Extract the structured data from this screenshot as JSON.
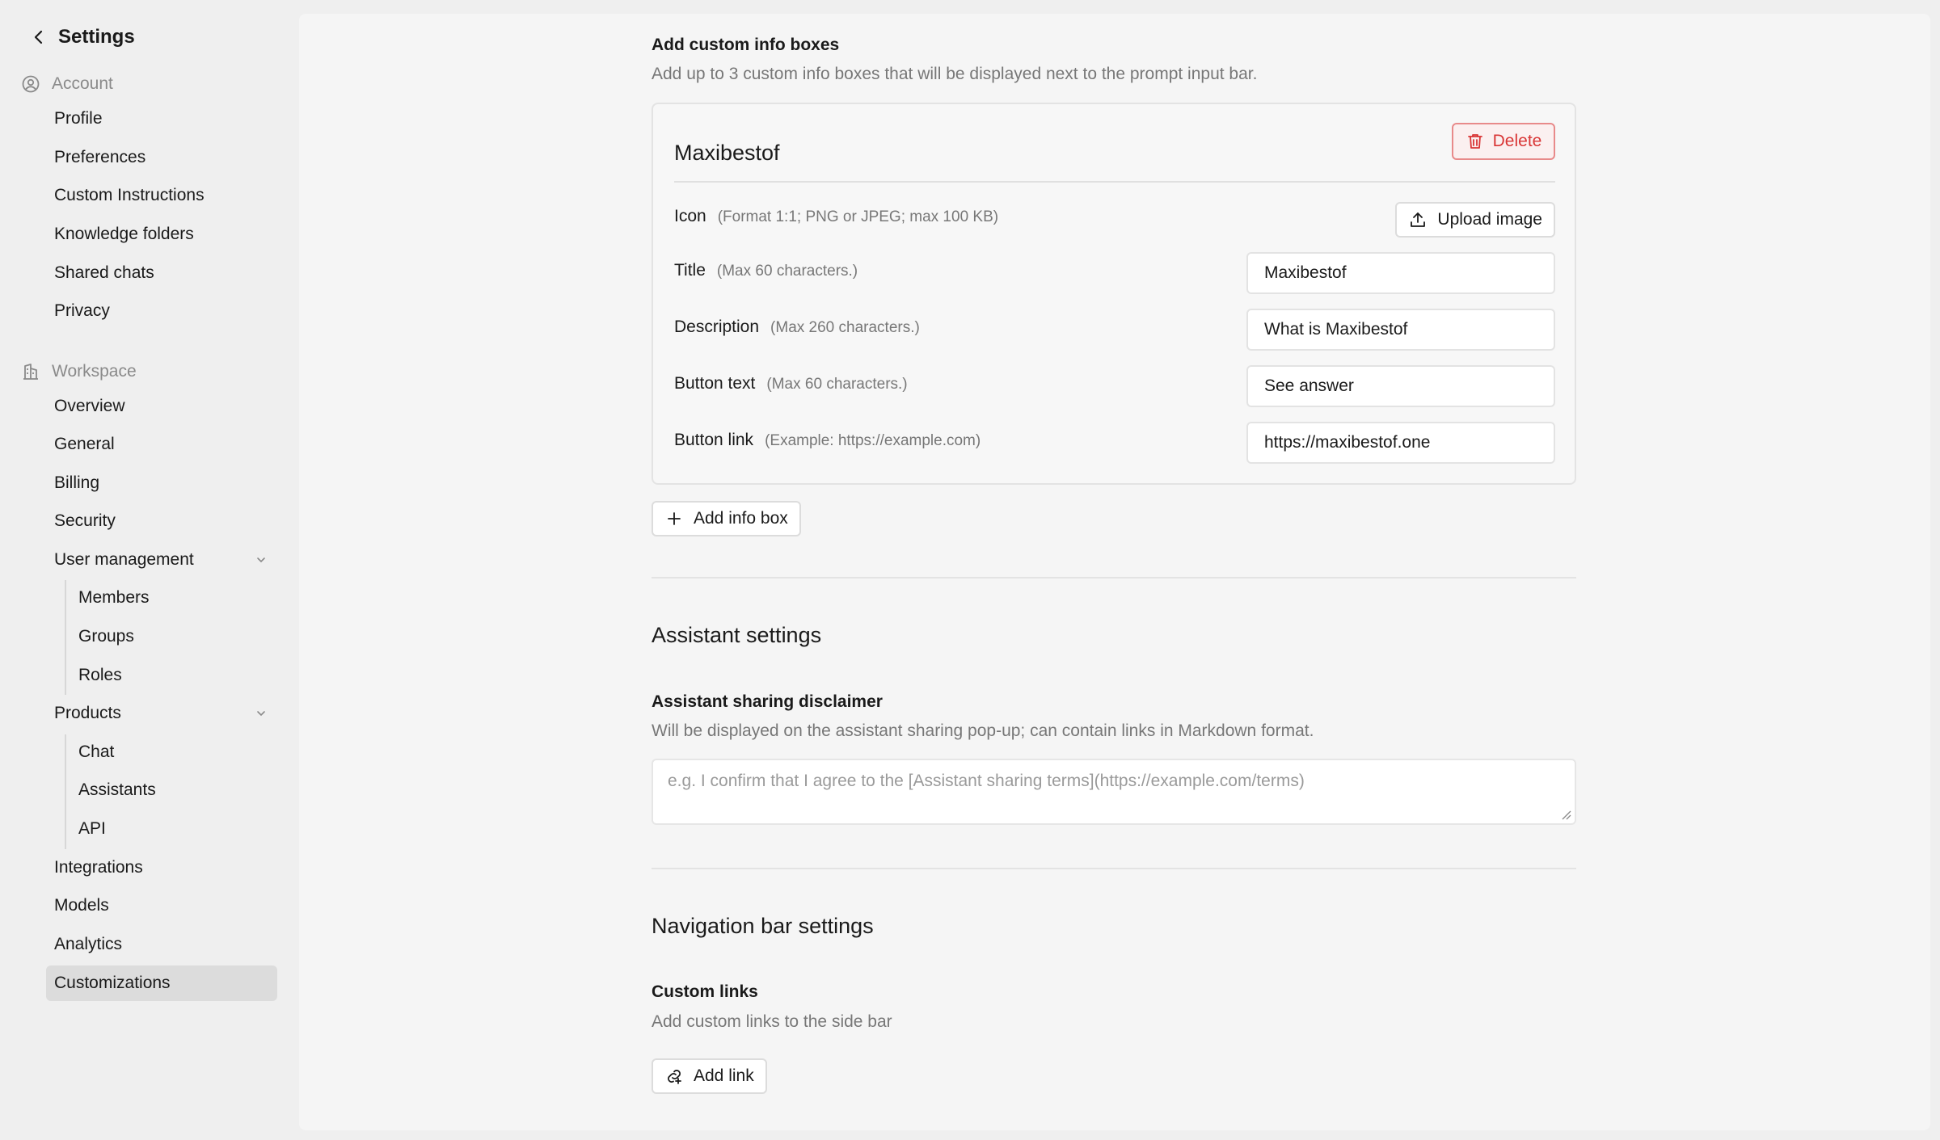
{
  "sidebar": {
    "header": {
      "title": "Settings"
    },
    "account": {
      "label": "Account",
      "items": [
        "Profile",
        "Preferences",
        "Custom Instructions",
        "Knowledge folders",
        "Shared chats",
        "Privacy"
      ]
    },
    "workspace": {
      "label": "Workspace",
      "items": {
        "overview": "Overview",
        "general": "General",
        "billing": "Billing",
        "security": "Security",
        "user_management": "User management",
        "members": "Members",
        "groups": "Groups",
        "roles": "Roles",
        "products": "Products",
        "chat": "Chat",
        "assistants": "Assistants",
        "api": "API",
        "integrations": "Integrations",
        "models": "Models",
        "analytics": "Analytics",
        "customizations": "Customizations"
      }
    }
  },
  "info_boxes": {
    "title": "Add custom info boxes",
    "description": "Add up to 3 custom info boxes that will be displayed next to the prompt input bar.",
    "card": {
      "name": "Maxibestof",
      "delete_label": "Delete",
      "icon": {
        "label": "Icon",
        "hint": "(Format 1:1; PNG or JPEG; max 100 KB)",
        "upload_label": "Upload image"
      },
      "title_field": {
        "label": "Title",
        "hint": "(Max 60 characters.)",
        "value": "Maxibestof"
      },
      "description_field": {
        "label": "Description",
        "hint": "(Max 260 characters.)",
        "value": "What is Maxibestof"
      },
      "button_text_field": {
        "label": "Button text",
        "hint": "(Max 60 characters.)",
        "value": "See answer"
      },
      "button_link_field": {
        "label": "Button link",
        "hint": "(Example: https://example.com)",
        "value": "https://maxibestof.one"
      }
    },
    "add_label": "Add info box"
  },
  "assistant_settings": {
    "title": "Assistant settings",
    "disclaimer_label": "Assistant sharing disclaimer",
    "disclaimer_description": "Will be displayed on the assistant sharing pop-up; can contain links in Markdown format.",
    "disclaimer_placeholder": "e.g. I confirm that I agree to the [Assistant sharing terms](https://example.com/terms)"
  },
  "navigation_settings": {
    "title": "Navigation bar settings",
    "links_label": "Custom links",
    "links_description": "Add custom links to the side bar",
    "add_link_label": "Add link"
  },
  "colors": {
    "danger": "#d93636",
    "active_item_bg": "#dcdcdc",
    "panel_bg": "#f5f5f5"
  }
}
